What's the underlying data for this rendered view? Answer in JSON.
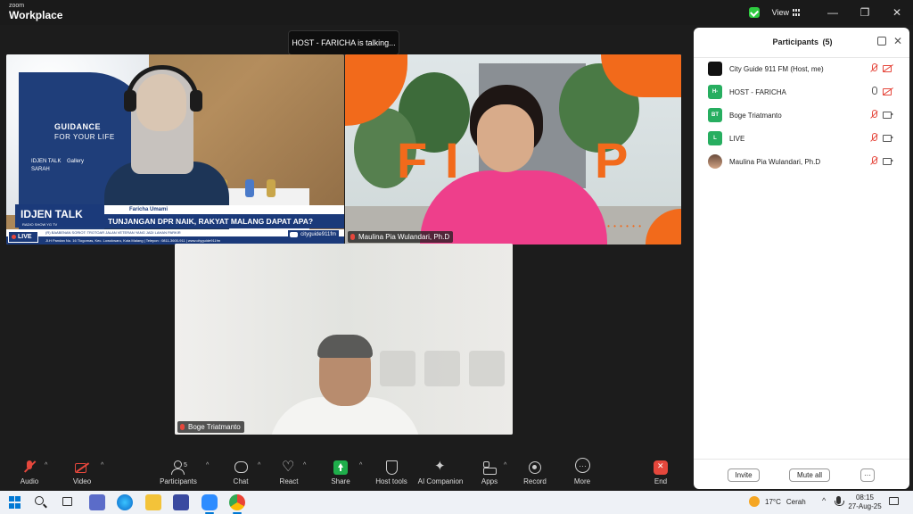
{
  "window": {
    "brand_small": "zoom",
    "brand_big": "Workplace",
    "view_label": "View",
    "controls": [
      "—",
      "❐",
      "✕"
    ],
    "colors": {
      "background": "#1c1c1c",
      "security_green": "#2ecc40"
    }
  },
  "toast": {
    "text": "HOST - FARICHA is talking..."
  },
  "tiles": [
    {
      "name": "",
      "broadcast": {
        "show": "IDJEN TALK",
        "show_tagline": "RADIO SHOW YG TV",
        "guidance_line1": "GUIDANCE",
        "guidance_line2": "FOR YOUR LIFE",
        "host_name": "Faricha Umami",
        "headline": "TUNJANGAN DPR NAIK, RAKYAT MALANG DAPAT APA?",
        "ticker": "(R) BAABENAN SORIOT: TROTOAR JALAN VETERAN YANG JADI LAHAN PARKIR",
        "address": "Jl.H Pandan No. 16 Tlogomas, Kec. Lowokwaru, Kota Malang | Telepon : 0811-3600-911 | www.cityguide911fm",
        "live_label": "LIVE",
        "youtube_handle": "cityguide911fm",
        "logos": [
          "IDJEN TALK",
          "Gallery",
          "SARAH"
        ]
      }
    },
    {
      "name": "Maulina Pia Wulandari, Ph.D",
      "letters": [
        "F",
        "I",
        "P"
      ],
      "dots": "• • • • • •"
    },
    {
      "name": "Boge Triatmanto"
    }
  ],
  "participants": {
    "title": "Participants",
    "count": "(5)",
    "list": [
      {
        "initials": "",
        "avatar": "logo",
        "name": "City Guide 911 FM (Host, me)",
        "mic": "off",
        "cam": "off"
      },
      {
        "initials": "H-",
        "avatar": "green",
        "name": "HOST - FARICHA",
        "mic": "on",
        "cam": "off"
      },
      {
        "initials": "BT",
        "avatar": "green",
        "name": "Boge Triatmanto",
        "mic": "off",
        "cam": "on"
      },
      {
        "initials": "L",
        "avatar": "green",
        "name": "LIVE",
        "mic": "off",
        "cam": "on"
      },
      {
        "initials": "",
        "avatar": "photo",
        "name": "Maulina Pia Wulandari, Ph.D",
        "mic": "off",
        "cam": "on"
      }
    ],
    "invite_label": "Invite",
    "mute_all_label": "Mute all",
    "more_label": "···"
  },
  "toolbar": {
    "audio": "Audio",
    "video": "Video",
    "participants": "Participants",
    "participants_count": "5",
    "chat": "Chat",
    "react": "React",
    "share": "Share",
    "host_tools": "Host tools",
    "ai_companion": "AI Companion",
    "apps": "Apps",
    "record": "Record",
    "more": "More",
    "end": "End"
  },
  "taskbar": {
    "apps": [
      "windows-start",
      "search",
      "task-view",
      "file-explorer",
      "edge",
      "folder",
      "store",
      "photos",
      "zoom",
      "chrome"
    ],
    "weather_temp": "17°C",
    "weather_desc": "Cerah",
    "time": "08:15",
    "date": "27-Aug-25"
  }
}
